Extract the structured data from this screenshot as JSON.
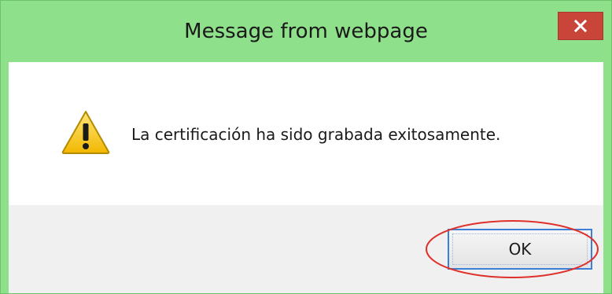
{
  "window": {
    "title": "Message from webpage",
    "close_icon": "close-icon"
  },
  "message": {
    "text": "La certificación ha sido grabada exitosamente.",
    "icon": "warning-icon"
  },
  "buttons": {
    "ok_label": "OK"
  },
  "colors": {
    "titlebar": "#8fe08a",
    "close_button": "#c9453a",
    "ok_border": "#3c7fd6",
    "annotation": "#e0302a"
  }
}
